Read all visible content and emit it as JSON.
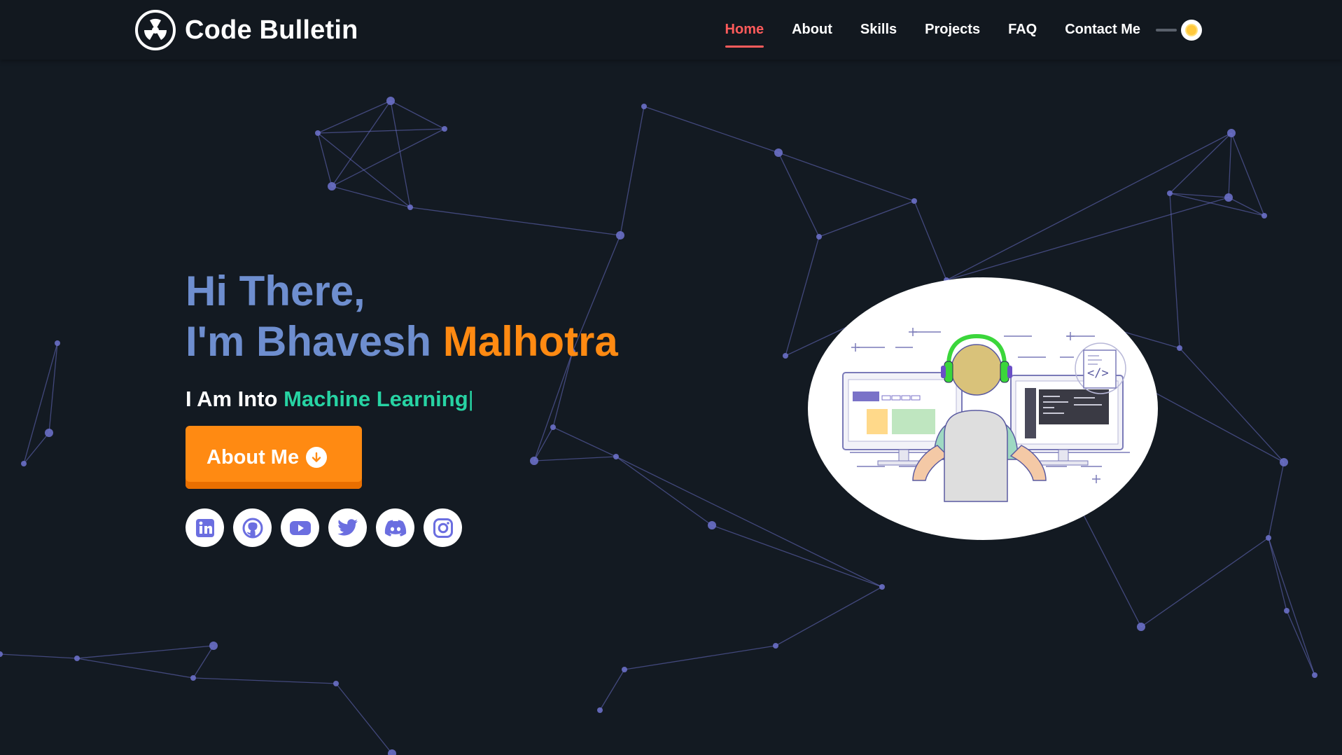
{
  "brand": {
    "name": "Code Bulletin",
    "logo_icon": "radiation-icon"
  },
  "nav": {
    "items": [
      {
        "label": "Home",
        "active": true
      },
      {
        "label": "About",
        "active": false
      },
      {
        "label": "Skills",
        "active": false
      },
      {
        "label": "Projects",
        "active": false
      },
      {
        "label": "FAQ",
        "active": false
      },
      {
        "label": "Contact Me",
        "active": false
      }
    ],
    "theme_toggle": {
      "icon": "sun-icon"
    }
  },
  "hero": {
    "greeting": "Hi There,",
    "intro_prefix": "I'm Bhavesh",
    "name_highlight": "Malhotra",
    "typing_prefix": "I Am Into",
    "typing_skill": "Machine Learning",
    "typing_cursor": "|",
    "button": {
      "label": "About Me",
      "icon": "arrow-down-circle-icon"
    }
  },
  "socials": [
    {
      "name": "linkedin",
      "icon": "linkedin-icon"
    },
    {
      "name": "github",
      "icon": "github-icon"
    },
    {
      "name": "youtube",
      "icon": "youtube-icon"
    },
    {
      "name": "twitter",
      "icon": "twitter-icon"
    },
    {
      "name": "discord",
      "icon": "discord-icon"
    },
    {
      "name": "instagram",
      "icon": "instagram-icon"
    }
  ],
  "illustration": {
    "description_icon": "developer-at-desk-illustration"
  },
  "colors": {
    "background": "#131a22",
    "navbar": "#12181f",
    "accent_orange": "#ff8a12",
    "title_blue": "#6e8ecf",
    "skill_green": "#27d3a3",
    "nav_active": "#ff5b5b",
    "particle": "#6a6fc6",
    "social_icon": "#6b6ee0"
  }
}
